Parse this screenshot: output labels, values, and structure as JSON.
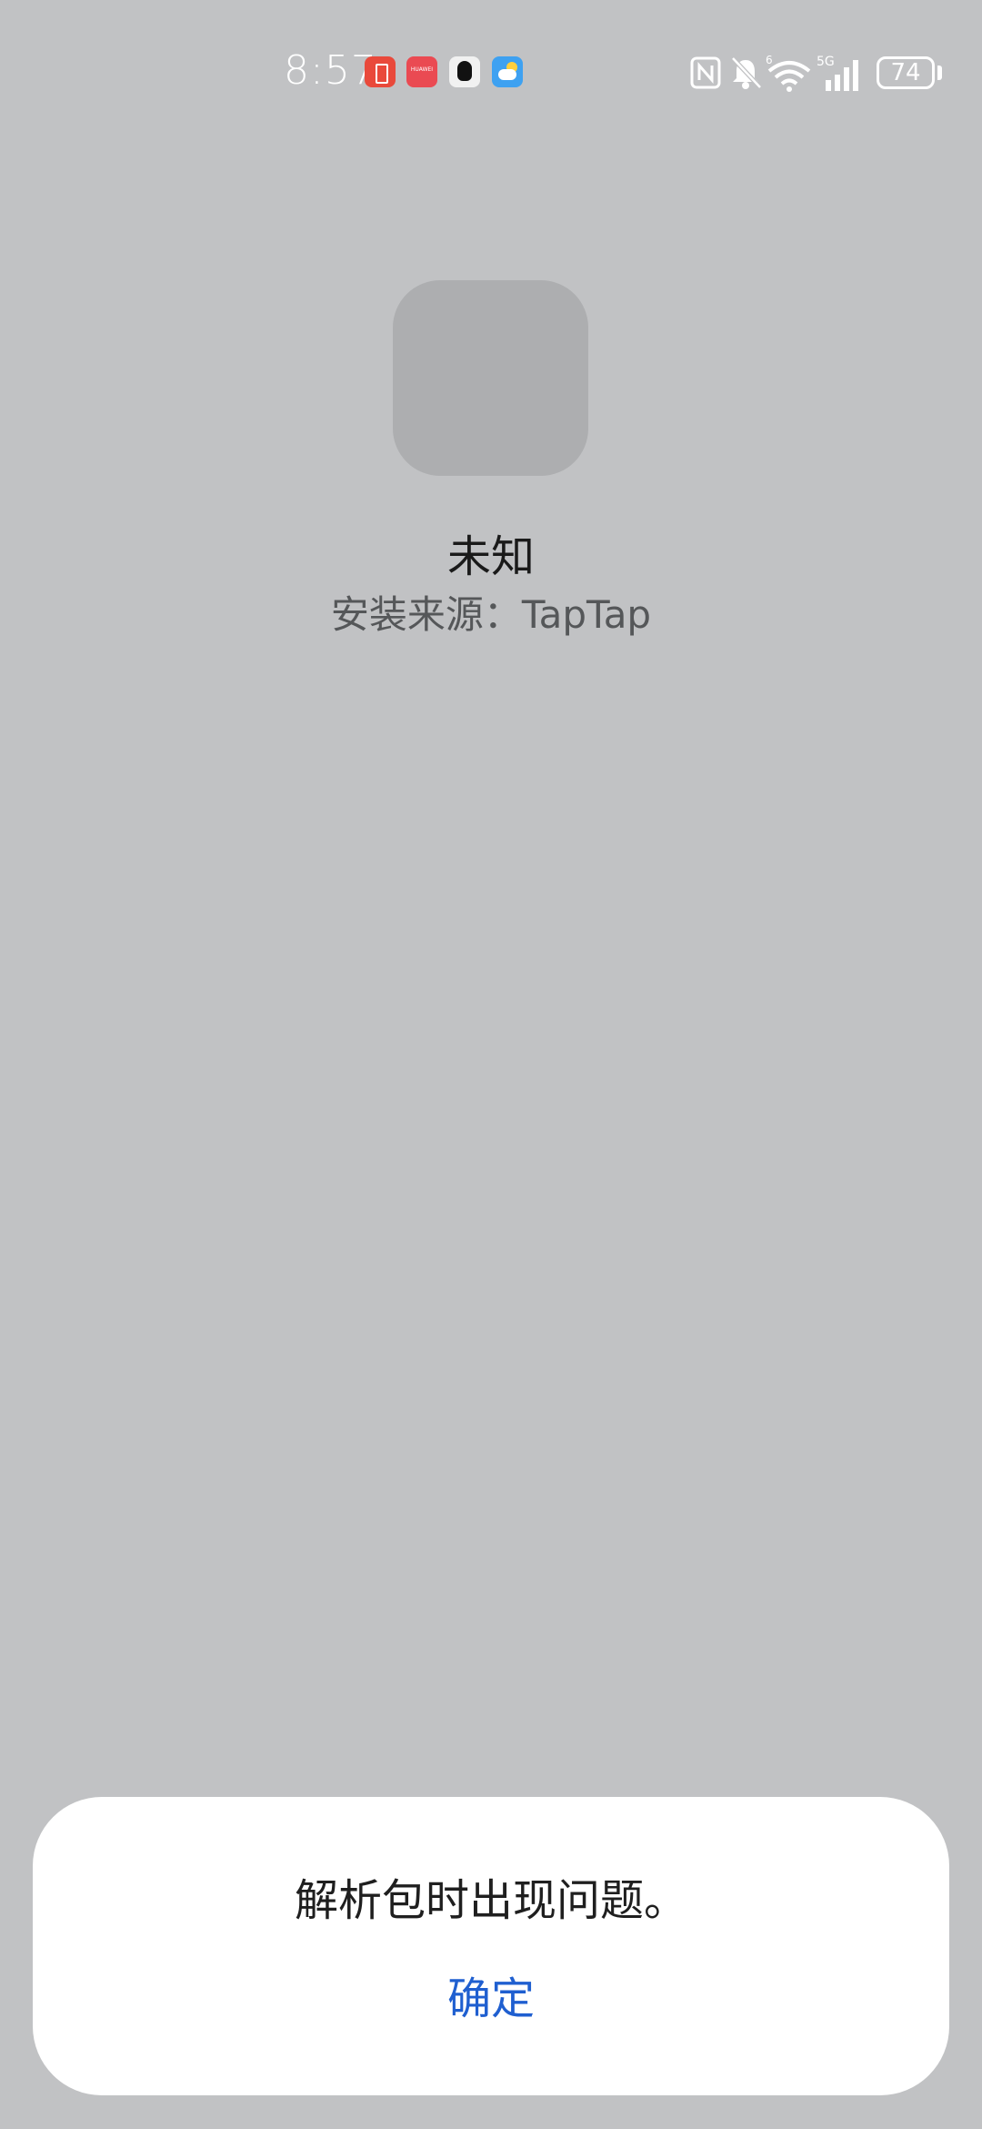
{
  "status_bar": {
    "time": "8:57",
    "battery_level": "74",
    "notification_icons": [
      "battery-saver-icon",
      "huawei-appgallery-icon",
      "qq-icon",
      "weather-icon"
    ],
    "system_icons": [
      "nfc-icon",
      "bell-muted-icon",
      "wifi-6-icon",
      "5g-signal-icon",
      "battery-icon"
    ]
  },
  "app": {
    "name": "未知",
    "install_source": "安装来源：TapTap"
  },
  "dialog": {
    "message": "解析包时出现问题。",
    "confirm_label": "确定"
  },
  "colors": {
    "background": "#c1c2c4",
    "accent": "#1f5fd0"
  }
}
